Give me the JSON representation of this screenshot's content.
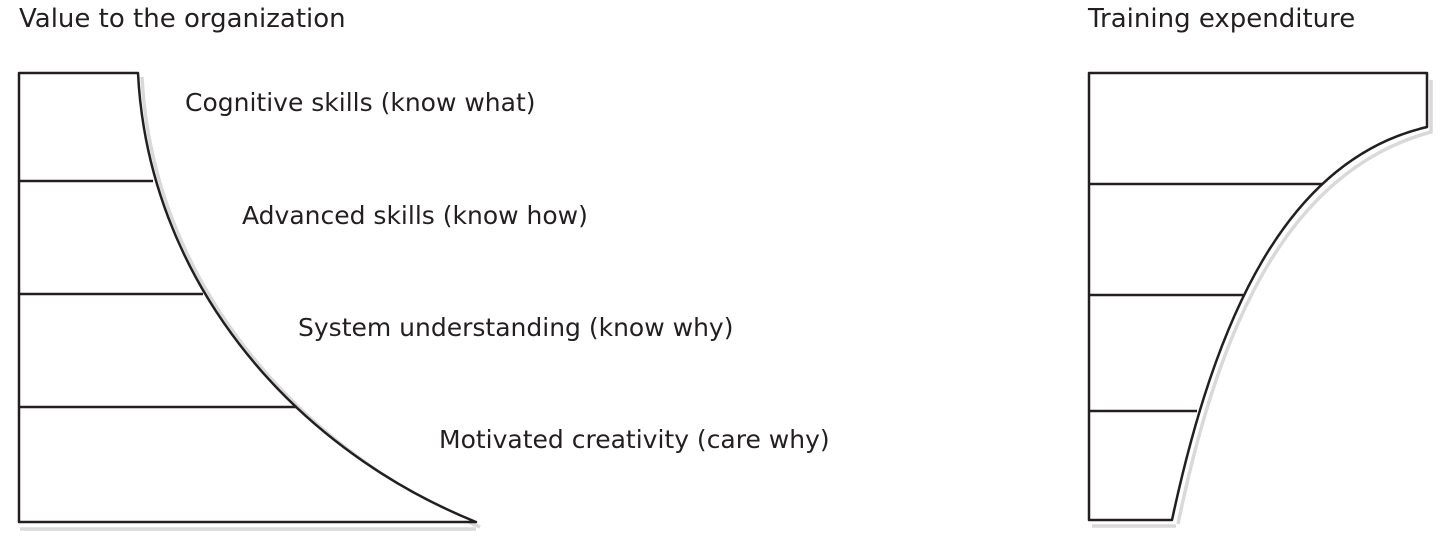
{
  "left_panel": {
    "title": "Value to the organization",
    "levels": [
      "Cognitive skills (know what)",
      "Advanced skills (know how)",
      "System understanding (know why)",
      "Motivated creativity (care why)"
    ]
  },
  "right_panel": {
    "title": "Training expenditure"
  }
}
